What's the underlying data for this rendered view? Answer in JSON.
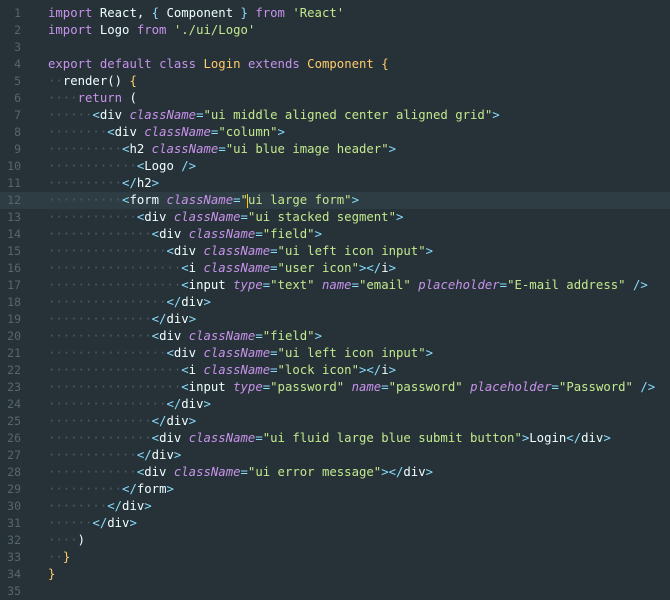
{
  "theme": {
    "background": "#263238",
    "active_line": "#2e3c43",
    "keyword": "#c792ea",
    "string": "#c3e88d",
    "punctuation": "#89ddff",
    "class_name": "#ffcb6b",
    "text": "#eeffff",
    "gutter": "#56666e",
    "whitespace_dots": "#4c5a61",
    "cursor": "#ffcc00"
  },
  "editor": {
    "active_line_number": 12,
    "lines": [
      {
        "number": "1",
        "tokens": [
          [
            "kw",
            "import"
          ],
          [
            "text",
            " React, "
          ],
          [
            "punc",
            "{"
          ],
          [
            "text",
            " Component "
          ],
          [
            "punc",
            "}"
          ],
          [
            "text",
            " "
          ],
          [
            "kw",
            "from"
          ],
          [
            "text",
            " "
          ],
          [
            "str",
            "'React'"
          ]
        ]
      },
      {
        "number": "2",
        "tokens": [
          [
            "kw",
            "import"
          ],
          [
            "text",
            " Logo "
          ],
          [
            "kw",
            "from"
          ],
          [
            "text",
            " "
          ],
          [
            "str",
            "'./ui/Logo'"
          ]
        ]
      },
      {
        "number": "3",
        "tokens": []
      },
      {
        "number": "4",
        "tokens": [
          [
            "kw",
            "export"
          ],
          [
            "text",
            " "
          ],
          [
            "kw",
            "default"
          ],
          [
            "text",
            " "
          ],
          [
            "kw",
            "class"
          ],
          [
            "text",
            " "
          ],
          [
            "comp",
            "Login"
          ],
          [
            "text",
            " "
          ],
          [
            "kw",
            "extends"
          ],
          [
            "text",
            " "
          ],
          [
            "comp",
            "Component"
          ],
          [
            "text",
            " "
          ],
          [
            "brace",
            "{"
          ]
        ]
      },
      {
        "number": "5",
        "tokens": [
          [
            "ws",
            "··"
          ],
          [
            "text",
            "render() "
          ],
          [
            "brace",
            "{"
          ]
        ]
      },
      {
        "number": "6",
        "tokens": [
          [
            "ws",
            "····"
          ],
          [
            "kw",
            "return"
          ],
          [
            "text",
            " ("
          ]
        ]
      },
      {
        "number": "7",
        "tokens": [
          [
            "ws",
            "······"
          ],
          [
            "punc",
            "<"
          ],
          [
            "tag",
            "div"
          ],
          [
            "text",
            " "
          ],
          [
            "attr",
            "className"
          ],
          [
            "eq",
            "="
          ],
          [
            "aval",
            "\"ui middle aligned center aligned grid\""
          ],
          [
            "punc",
            ">"
          ]
        ]
      },
      {
        "number": "8",
        "tokens": [
          [
            "ws",
            "········"
          ],
          [
            "punc",
            "<"
          ],
          [
            "tag",
            "div"
          ],
          [
            "text",
            " "
          ],
          [
            "attr",
            "className"
          ],
          [
            "eq",
            "="
          ],
          [
            "aval",
            "\"column\""
          ],
          [
            "punc",
            ">"
          ]
        ]
      },
      {
        "number": "9",
        "tokens": [
          [
            "ws",
            "··········"
          ],
          [
            "punc",
            "<"
          ],
          [
            "tag",
            "h2"
          ],
          [
            "text",
            " "
          ],
          [
            "attr",
            "className"
          ],
          [
            "eq",
            "="
          ],
          [
            "aval",
            "\"ui blue image header\""
          ],
          [
            "punc",
            ">"
          ]
        ]
      },
      {
        "number": "10",
        "tokens": [
          [
            "ws",
            "············"
          ],
          [
            "punc",
            "<"
          ],
          [
            "tag",
            "Logo"
          ],
          [
            "text",
            " "
          ],
          [
            "punc",
            "/>"
          ]
        ]
      },
      {
        "number": "11",
        "tokens": [
          [
            "ws",
            "··········"
          ],
          [
            "punc",
            "</"
          ],
          [
            "tag",
            "h2"
          ],
          [
            "punc",
            ">"
          ]
        ]
      },
      {
        "number": "12",
        "tokens": [
          [
            "ws",
            "··········"
          ],
          [
            "punc",
            "<"
          ],
          [
            "tag",
            "form"
          ],
          [
            "text",
            " "
          ],
          [
            "attr",
            "className"
          ],
          [
            "eq",
            "="
          ],
          [
            "aval",
            "\""
          ],
          [
            "cursor",
            ""
          ],
          [
            "aval",
            "ui large form\""
          ],
          [
            "punc",
            ">"
          ]
        ]
      },
      {
        "number": "13",
        "tokens": [
          [
            "ws",
            "············"
          ],
          [
            "punc",
            "<"
          ],
          [
            "tag",
            "div"
          ],
          [
            "text",
            " "
          ],
          [
            "attr",
            "className"
          ],
          [
            "eq",
            "="
          ],
          [
            "aval",
            "\"ui stacked segment\""
          ],
          [
            "punc",
            ">"
          ]
        ]
      },
      {
        "number": "14",
        "tokens": [
          [
            "ws",
            "··············"
          ],
          [
            "punc",
            "<"
          ],
          [
            "tag",
            "div"
          ],
          [
            "text",
            " "
          ],
          [
            "attr",
            "className"
          ],
          [
            "eq",
            "="
          ],
          [
            "aval",
            "\"field\""
          ],
          [
            "punc",
            ">"
          ]
        ]
      },
      {
        "number": "15",
        "tokens": [
          [
            "ws",
            "················"
          ],
          [
            "punc",
            "<"
          ],
          [
            "tag",
            "div"
          ],
          [
            "text",
            " "
          ],
          [
            "attr",
            "className"
          ],
          [
            "eq",
            "="
          ],
          [
            "aval",
            "\"ui left icon input\""
          ],
          [
            "punc",
            ">"
          ]
        ]
      },
      {
        "number": "16",
        "tokens": [
          [
            "ws",
            "··················"
          ],
          [
            "punc",
            "<"
          ],
          [
            "tag",
            "i"
          ],
          [
            "text",
            " "
          ],
          [
            "attr",
            "className"
          ],
          [
            "eq",
            "="
          ],
          [
            "aval",
            "\"user icon\""
          ],
          [
            "punc",
            "></"
          ],
          [
            "tag",
            "i"
          ],
          [
            "punc",
            ">"
          ]
        ]
      },
      {
        "number": "17",
        "tokens": [
          [
            "ws",
            "··················"
          ],
          [
            "punc",
            "<"
          ],
          [
            "tag",
            "input"
          ],
          [
            "text",
            " "
          ],
          [
            "attr",
            "type"
          ],
          [
            "eq",
            "="
          ],
          [
            "aval",
            "\"text\""
          ],
          [
            "text",
            " "
          ],
          [
            "attr",
            "name"
          ],
          [
            "eq",
            "="
          ],
          [
            "aval",
            "\"email\""
          ],
          [
            "text",
            " "
          ],
          [
            "attr",
            "placeholder"
          ],
          [
            "eq",
            "="
          ],
          [
            "aval",
            "\"E-mail address\""
          ],
          [
            "text",
            " "
          ],
          [
            "punc",
            "/>"
          ]
        ]
      },
      {
        "number": "18",
        "tokens": [
          [
            "ws",
            "················"
          ],
          [
            "punc",
            "</"
          ],
          [
            "tag",
            "div"
          ],
          [
            "punc",
            ">"
          ]
        ]
      },
      {
        "number": "19",
        "tokens": [
          [
            "ws",
            "··············"
          ],
          [
            "punc",
            "</"
          ],
          [
            "tag",
            "div"
          ],
          [
            "punc",
            ">"
          ]
        ]
      },
      {
        "number": "20",
        "tokens": [
          [
            "ws",
            "··············"
          ],
          [
            "punc",
            "<"
          ],
          [
            "tag",
            "div"
          ],
          [
            "text",
            " "
          ],
          [
            "attr",
            "className"
          ],
          [
            "eq",
            "="
          ],
          [
            "aval",
            "\"field\""
          ],
          [
            "punc",
            ">"
          ]
        ]
      },
      {
        "number": "21",
        "tokens": [
          [
            "ws",
            "················"
          ],
          [
            "punc",
            "<"
          ],
          [
            "tag",
            "div"
          ],
          [
            "text",
            " "
          ],
          [
            "attr",
            "className"
          ],
          [
            "eq",
            "="
          ],
          [
            "aval",
            "\"ui left icon input\""
          ],
          [
            "punc",
            ">"
          ]
        ]
      },
      {
        "number": "22",
        "tokens": [
          [
            "ws",
            "··················"
          ],
          [
            "punc",
            "<"
          ],
          [
            "tag",
            "i"
          ],
          [
            "text",
            " "
          ],
          [
            "attr",
            "className"
          ],
          [
            "eq",
            "="
          ],
          [
            "aval",
            "\"lock icon\""
          ],
          [
            "punc",
            "></"
          ],
          [
            "tag",
            "i"
          ],
          [
            "punc",
            ">"
          ]
        ]
      },
      {
        "number": "23",
        "tokens": [
          [
            "ws",
            "··················"
          ],
          [
            "punc",
            "<"
          ],
          [
            "tag",
            "input"
          ],
          [
            "text",
            " "
          ],
          [
            "attr",
            "type"
          ],
          [
            "eq",
            "="
          ],
          [
            "aval",
            "\"password\""
          ],
          [
            "text",
            " "
          ],
          [
            "attr",
            "name"
          ],
          [
            "eq",
            "="
          ],
          [
            "aval",
            "\"password\""
          ],
          [
            "text",
            " "
          ],
          [
            "attr",
            "placeholder"
          ],
          [
            "eq",
            "="
          ],
          [
            "aval",
            "\"Password\""
          ],
          [
            "text",
            " "
          ],
          [
            "punc",
            "/>"
          ]
        ]
      },
      {
        "number": "24",
        "tokens": [
          [
            "ws",
            "················"
          ],
          [
            "punc",
            "</"
          ],
          [
            "tag",
            "div"
          ],
          [
            "punc",
            ">"
          ]
        ]
      },
      {
        "number": "25",
        "tokens": [
          [
            "ws",
            "··············"
          ],
          [
            "punc",
            "</"
          ],
          [
            "tag",
            "div"
          ],
          [
            "punc",
            ">"
          ]
        ]
      },
      {
        "number": "26",
        "tokens": [
          [
            "ws",
            "··············"
          ],
          [
            "punc",
            "<"
          ],
          [
            "tag",
            "div"
          ],
          [
            "text",
            " "
          ],
          [
            "attr",
            "className"
          ],
          [
            "eq",
            "="
          ],
          [
            "aval",
            "\"ui fluid large blue submit button\""
          ],
          [
            "punc",
            ">"
          ],
          [
            "text",
            "Login"
          ],
          [
            "punc",
            "</"
          ],
          [
            "tag",
            "div"
          ],
          [
            "punc",
            ">"
          ]
        ]
      },
      {
        "number": "27",
        "tokens": [
          [
            "ws",
            "············"
          ],
          [
            "punc",
            "</"
          ],
          [
            "tag",
            "div"
          ],
          [
            "punc",
            ">"
          ]
        ]
      },
      {
        "number": "28",
        "tokens": [
          [
            "ws",
            "············"
          ],
          [
            "punc",
            "<"
          ],
          [
            "tag",
            "div"
          ],
          [
            "text",
            " "
          ],
          [
            "attr",
            "className"
          ],
          [
            "eq",
            "="
          ],
          [
            "aval",
            "\"ui error message\""
          ],
          [
            "punc",
            "></"
          ],
          [
            "tag",
            "div"
          ],
          [
            "punc",
            ">"
          ]
        ]
      },
      {
        "number": "29",
        "tokens": [
          [
            "ws",
            "··········"
          ],
          [
            "punc",
            "</"
          ],
          [
            "tag",
            "form"
          ],
          [
            "punc",
            ">"
          ]
        ]
      },
      {
        "number": "30",
        "tokens": [
          [
            "ws",
            "········"
          ],
          [
            "punc",
            "</"
          ],
          [
            "tag",
            "div"
          ],
          [
            "punc",
            ">"
          ]
        ]
      },
      {
        "number": "31",
        "tokens": [
          [
            "ws",
            "······"
          ],
          [
            "punc",
            "</"
          ],
          [
            "tag",
            "div"
          ],
          [
            "punc",
            ">"
          ]
        ]
      },
      {
        "number": "32",
        "tokens": [
          [
            "ws",
            "····"
          ],
          [
            "text",
            ")"
          ]
        ]
      },
      {
        "number": "33",
        "tokens": [
          [
            "ws",
            "··"
          ],
          [
            "brace",
            "}"
          ]
        ]
      },
      {
        "number": "34",
        "tokens": [
          [
            "brace",
            "}"
          ]
        ]
      },
      {
        "number": "35",
        "tokens": []
      }
    ]
  }
}
